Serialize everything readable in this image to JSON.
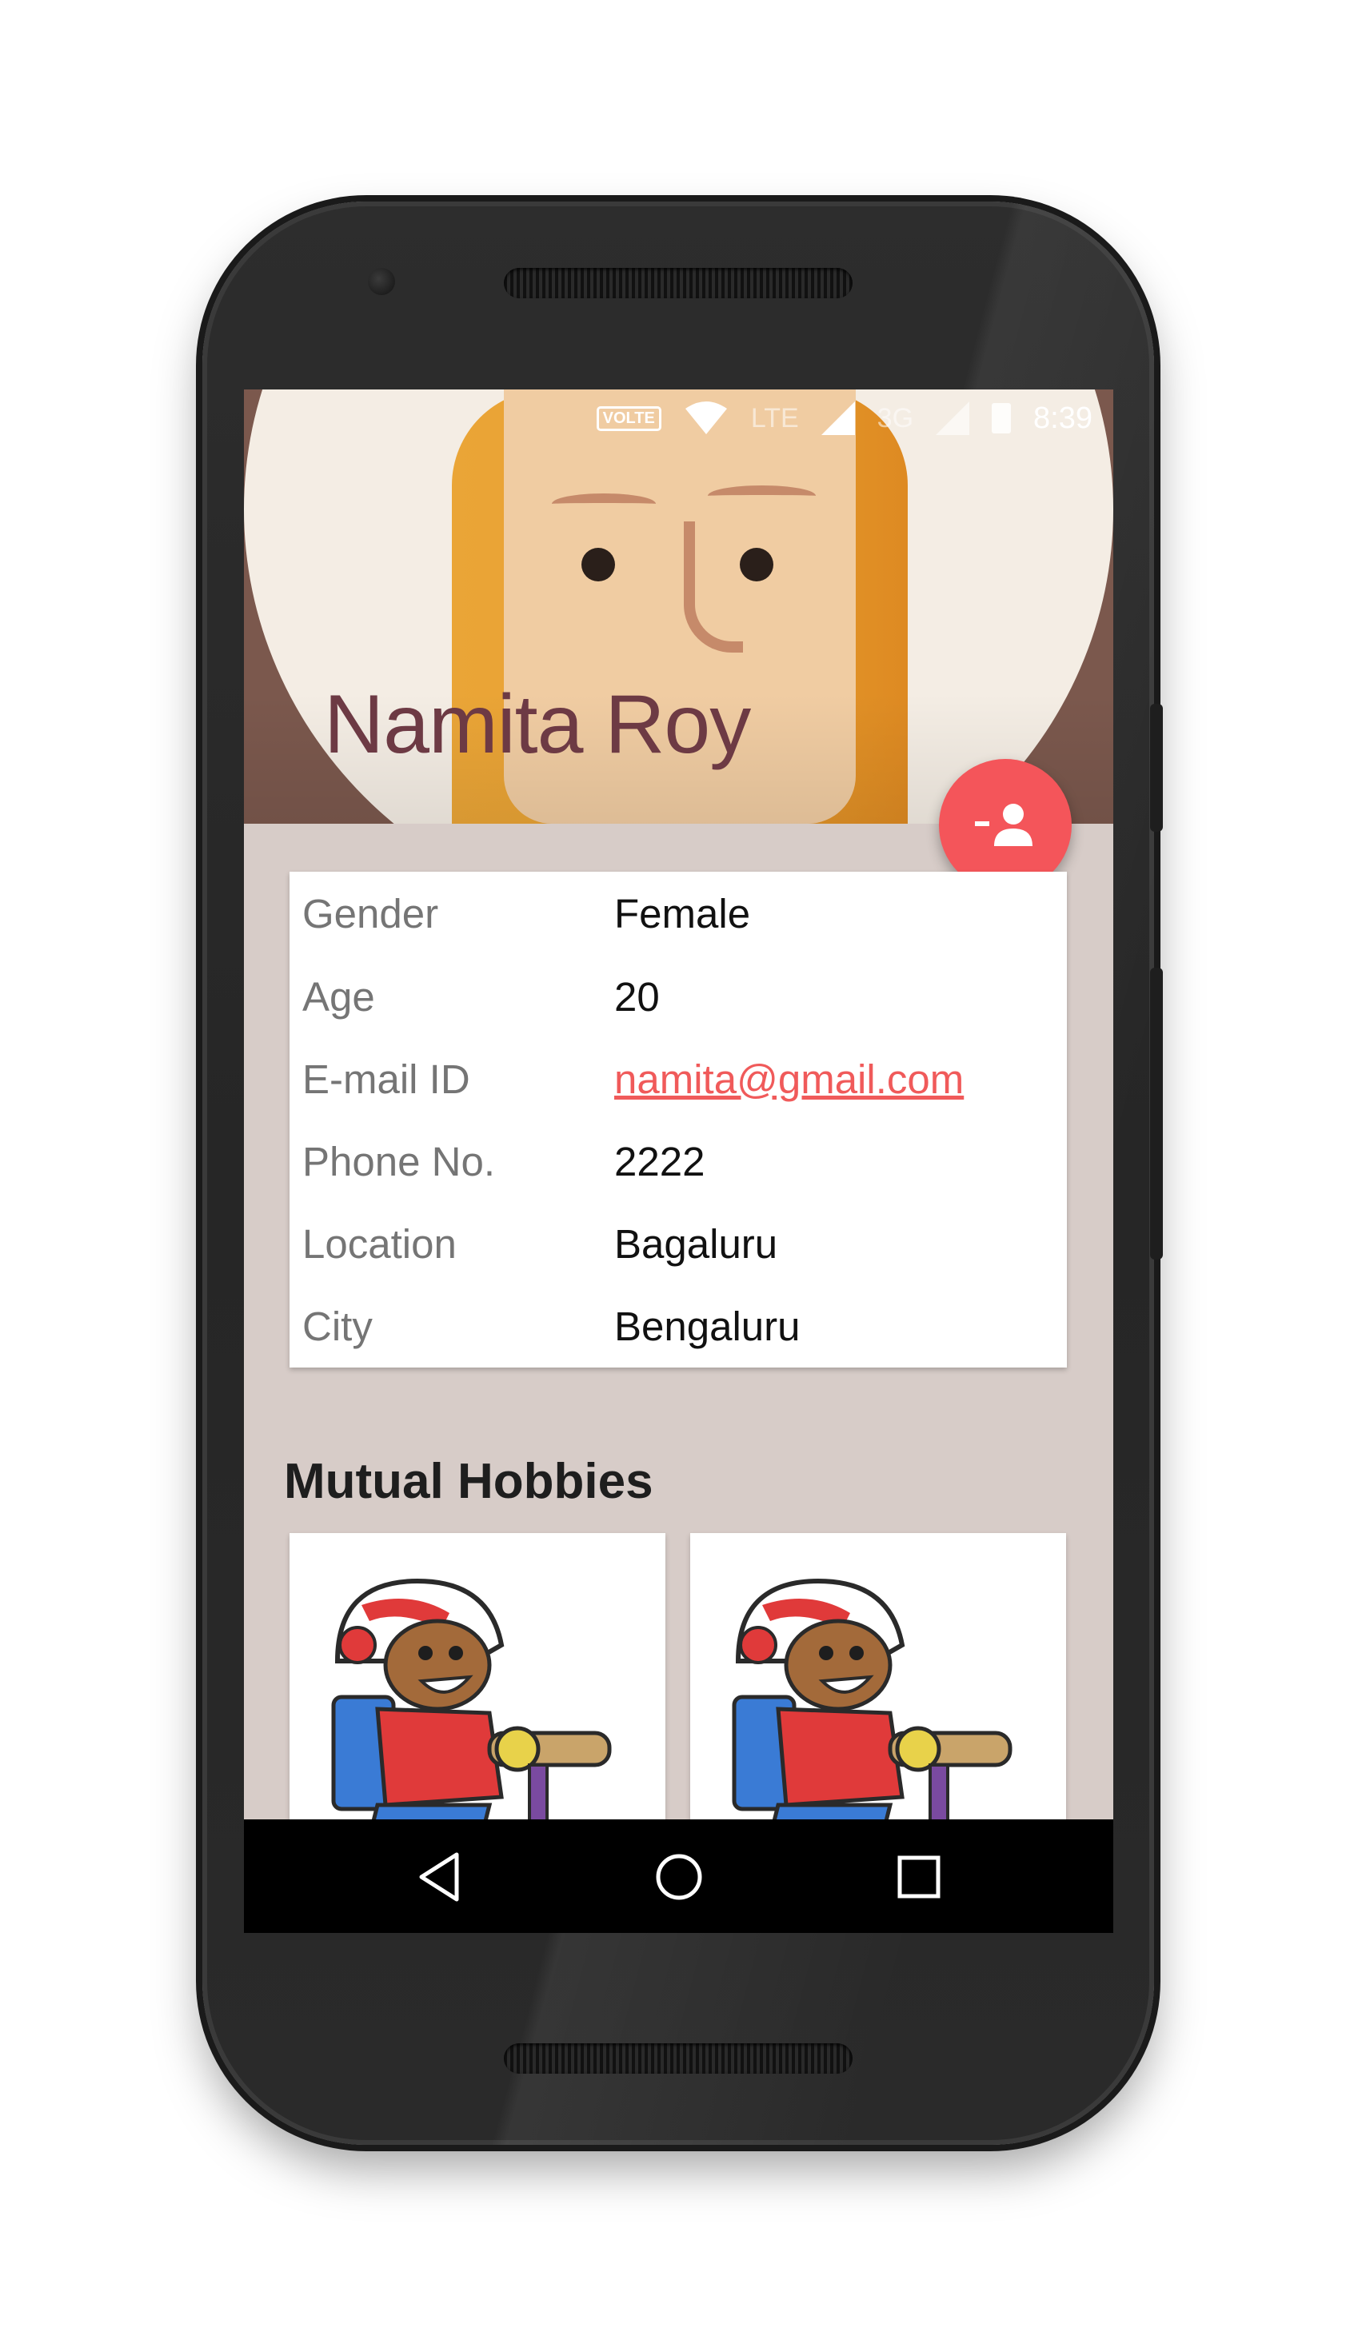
{
  "status_bar": {
    "volte": "VOLTE",
    "lte": "LTE",
    "network_3g": "3G",
    "time": "8:39"
  },
  "profile": {
    "name": "Namita Roy"
  },
  "details": [
    {
      "label": "Gender",
      "value": "Female"
    },
    {
      "label": "Age",
      "value": "20"
    },
    {
      "label": "E-mail ID",
      "value": "namita@gmail.com"
    },
    {
      "label": "Phone No.",
      "value": "2222"
    },
    {
      "label": "Location",
      "value": "Bagaluru"
    },
    {
      "label": "City",
      "value": "Bengaluru"
    }
  ],
  "hobbies": {
    "title": "Mutual Hobbies",
    "items": [
      {
        "icon": "scooter-kid-icon"
      },
      {
        "icon": "scooter-kid-icon"
      }
    ]
  },
  "fab": {
    "icon": "add-friend-icon"
  },
  "navigation": {
    "icons": [
      "back-icon",
      "home-icon",
      "recents-icon"
    ]
  },
  "colors": {
    "accent": "#f4555a",
    "link": "#f05a5a",
    "background": "#d7ccc8",
    "name_text": "#6d3a44"
  }
}
